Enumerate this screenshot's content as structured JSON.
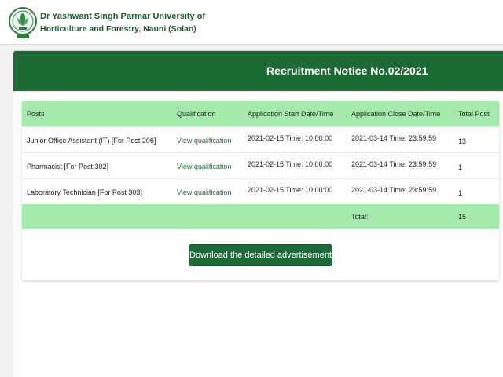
{
  "header": {
    "university_line1": "Dr Yashwant Singh Parmar University of",
    "university_line2": "Horticulture and Forestry, Nauni (Solan)"
  },
  "notice": {
    "title": "Recruitment Notice No.02/2021"
  },
  "table": {
    "columns": {
      "posts": "Posts",
      "qualification": "Qualification",
      "start": "Application Start Date/Time",
      "close": "Application Close Date/Time",
      "total": "Total Post"
    },
    "rows": [
      {
        "post": "Junior Office Assistant (IT) [For Post 206]",
        "qualification": "View qualification",
        "start": "2021-02-15 Time: 10:00:00",
        "close": "2021-03-14 Time: 23:59:59",
        "total": "13"
      },
      {
        "post": "Pharmacist [For Post 302]",
        "qualification": "View qualification",
        "start": "2021-02-15 Time: 10:00:00",
        "close": "2021-03-14 Time: 23:59:59",
        "total": "1"
      },
      {
        "post": "Laboratory Technician [For Post 303]",
        "qualification": "View qualification",
        "start": "2021-02-15 Time: 10:00:00",
        "close": "2021-03-14 Time: 23:59:59",
        "total": "1"
      }
    ],
    "footer": {
      "label": "Total:",
      "value": "15"
    }
  },
  "actions": {
    "download_label": "Download the detailed advertisement"
  },
  "colors": {
    "brand_green": "#1d6a35",
    "table_header_green": "#a6e9ad",
    "link_green": "#1d6a35"
  }
}
